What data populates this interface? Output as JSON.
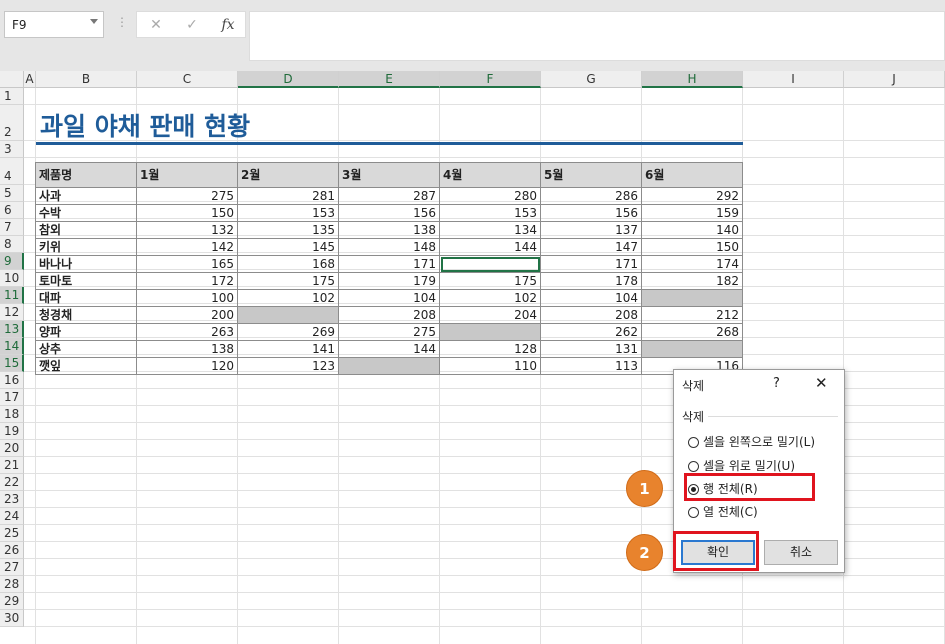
{
  "formula_bar": {
    "name_box": "F9",
    "cancel_icon": "✕",
    "enter_icon": "✓",
    "fx_icon": "fx",
    "formula": ""
  },
  "columns": [
    "A",
    "B",
    "C",
    "D",
    "E",
    "F",
    "G",
    "H",
    "I",
    "J"
  ],
  "rows": [
    "1",
    "2",
    "3",
    "4",
    "5",
    "6",
    "7",
    "8",
    "9",
    "10",
    "11",
    "12",
    "13",
    "14",
    "15",
    "16",
    "17",
    "18",
    "19",
    "20",
    "21",
    "22",
    "23",
    "24",
    "25",
    "26",
    "27",
    "28",
    "29",
    "30"
  ],
  "sheet": {
    "title": "과일 야채 판매 현황",
    "headers": [
      "제품명",
      "1월",
      "2월",
      "3월",
      "4월",
      "5월",
      "6월"
    ],
    "data": [
      [
        "사과",
        "275",
        "281",
        "287",
        "280",
        "286",
        "292"
      ],
      [
        "수박",
        "150",
        "153",
        "156",
        "153",
        "156",
        "159"
      ],
      [
        "참외",
        "132",
        "135",
        "138",
        "134",
        "137",
        "140"
      ],
      [
        "키위",
        "142",
        "145",
        "148",
        "144",
        "147",
        "150"
      ],
      [
        "바나나",
        "165",
        "168",
        "171",
        "",
        "171",
        "174"
      ],
      [
        "토마토",
        "172",
        "175",
        "179",
        "175",
        "178",
        "182"
      ],
      [
        "대파",
        "100",
        "102",
        "104",
        "102",
        "104",
        ""
      ],
      [
        "청경채",
        "200",
        "",
        "208",
        "204",
        "208",
        "212"
      ],
      [
        "양파",
        "263",
        "269",
        "275",
        "",
        "262",
        "268"
      ],
      [
        "상추",
        "138",
        "141",
        "144",
        "128",
        "131",
        ""
      ],
      [
        "깻잎",
        "120",
        "123",
        "",
        "110",
        "113",
        "116"
      ]
    ]
  },
  "dialog": {
    "title": "삭제",
    "help": "?",
    "close": "✕",
    "group_label": "삭제",
    "options": [
      "셀을 왼쪽으로 밀기(L)",
      "셀을 위로 밀기(U)",
      "행 전체(R)",
      "열 전체(C)"
    ],
    "selected_option": 2,
    "ok": "확인",
    "cancel": "취소"
  },
  "callouts": [
    "1",
    "2"
  ],
  "colors": {
    "title_blue": "#1f5c99",
    "callout_orange": "#e8832d",
    "highlight_red": "#e0141e",
    "excel_green": "#217346"
  }
}
